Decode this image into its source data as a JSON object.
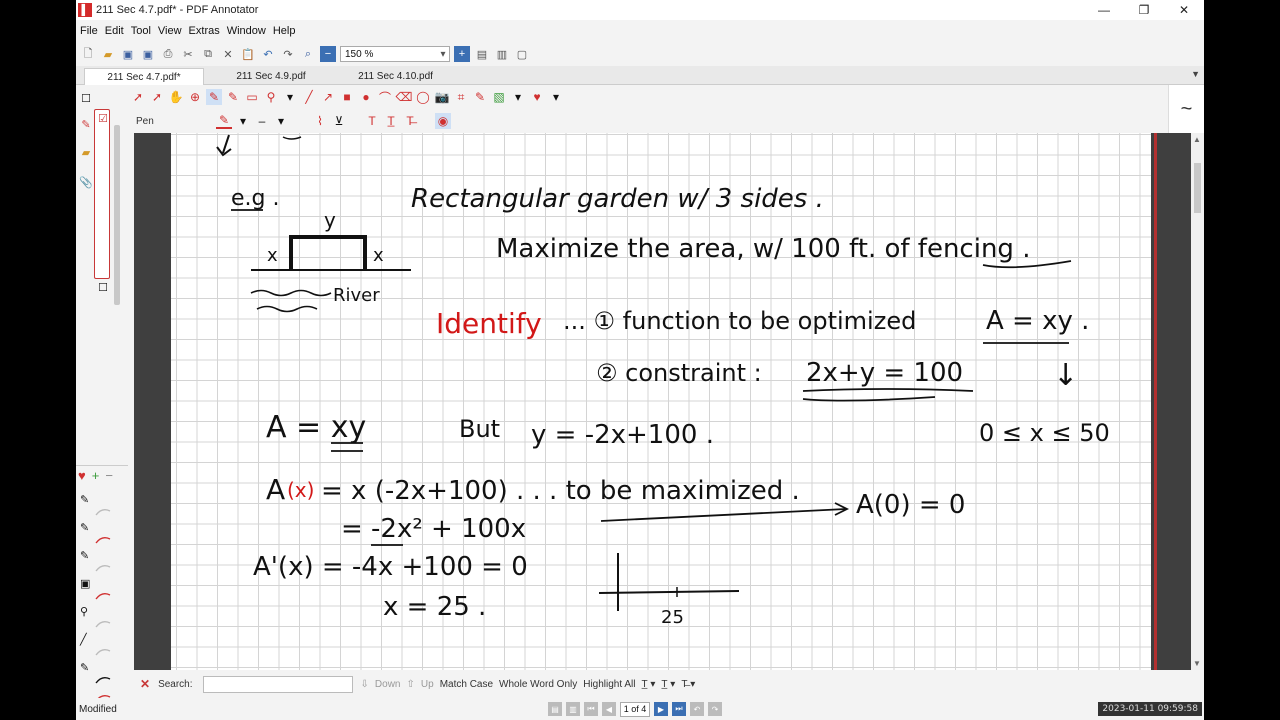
{
  "window": {
    "title": "211 Sec 4.7.pdf* - PDF Annotator",
    "app_icon": "pdf-annotator-icon",
    "controls": [
      "minimize-icon",
      "maximize-icon",
      "close-icon"
    ]
  },
  "menu": {
    "items": [
      "File",
      "Edit",
      "Tool",
      "View",
      "Extras",
      "Window",
      "Help"
    ]
  },
  "toolbar": {
    "zoom": "150 %"
  },
  "tabs": [
    {
      "label": "211 Sec 4.7.pdf*",
      "active": true
    },
    {
      "label": "211 Sec 4.9.pdf",
      "active": false
    },
    {
      "label": "211 Sec 4.10.pdf",
      "active": false
    }
  ],
  "pen_bar": {
    "tool_label": "Pen"
  },
  "right_panel": {
    "icon": "tilde-stroke-icon",
    "glyph": "~"
  },
  "page_content": {
    "line1_eg": "e.g .",
    "line1": "Rectangular garden w/ 3 sides .",
    "diagram_y": "y",
    "diagram_x_left": "x",
    "diagram_x_right": "x",
    "diagram_river": "River",
    "line2": "Maximize the area, w/ 100 ft. of fencing .",
    "identify": "Identify",
    "identify_rest": "... ① function to be optimized",
    "eq_area": "A = xy .",
    "constraint": "② constraint :",
    "eq_constraint": "2x+y = 100",
    "arrow_down": "↓",
    "domain": "0 ≤ x ≤ 50",
    "a_xy": "A = xy",
    "but": "But",
    "y_sub": "y = -2x+100 .",
    "ax_prefix": "A",
    "ax_paren": "(x)",
    "ax_rest": "= x (-2x+100) . . . to be maximized .",
    "a0": "A(0) = 0",
    "simplified": "= -2x² + 100x",
    "derivative": "A'(x) = -4x +100 = 0",
    "x25": "x = 25 .",
    "axis_label": "25"
  },
  "search": {
    "label": "Search:",
    "value": "",
    "down": "Down",
    "up": "Up",
    "match_case": "Match Case",
    "whole_word": "Whole Word Only",
    "highlight_all": "Highlight All"
  },
  "status": {
    "text": "Modified",
    "page_display": "1 of 4",
    "timestamp": "2023-01-11 09:59:58"
  },
  "colors": {
    "accent_red": "#d21818",
    "nav_blue": "#3b6fb3"
  }
}
